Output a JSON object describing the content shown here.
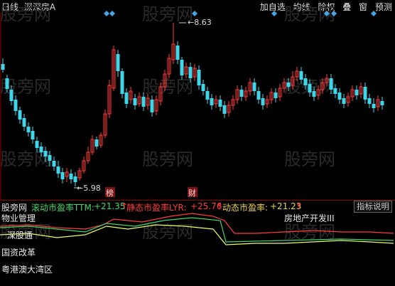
{
  "toolbar": {
    "period": "日线",
    "symbol": "深深房A",
    "buttons": [
      "加自选",
      "均线",
      "除权",
      "叠",
      "窗",
      "预测"
    ]
  },
  "chart": {
    "high_label": "8.63",
    "low_label": "5.98",
    "markers": [
      "榜",
      "财"
    ],
    "colors": {
      "up": "#ff3b3b",
      "down": "#3fd6ea",
      "diamond": "#44a6e8",
      "marker_bg": "#7a1414"
    }
  },
  "indicator_bar": {
    "title": "股旁网",
    "ttm_label": "滚动市盈率TTM:",
    "ttm_value": "+21.35",
    "lyr_label": "静态市盈率LYR:",
    "lyr_value": "+25.76",
    "dyn_label": "动态市盈率:",
    "dyn_value": "+21.23",
    "explain_button": "指标说明"
  },
  "lower": {
    "labels": [
      "物业管理",
      "深股通",
      "国资改革",
      "粤港澳大湾区",
      "房地产开发III"
    ]
  },
  "watermark": "股旁网"
}
